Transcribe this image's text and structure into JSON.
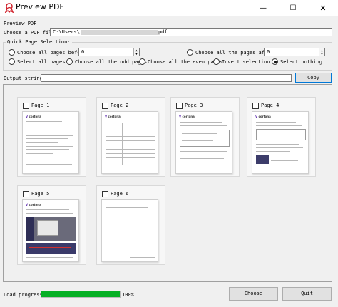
{
  "window": {
    "title": "Preview PDF",
    "minimize_glyph": "—",
    "maximize_glyph": "☐",
    "close_glyph": "✕"
  },
  "header": {
    "label": "Preview PDF"
  },
  "file": {
    "label": "Choose a PDF file:",
    "path_prefix": "C:\\Users\\",
    "path_suffix": "pdf"
  },
  "selection": {
    "group_title": "Quick Page Selection:",
    "pages_before_label": "Choose all pages before",
    "pages_before_value": "0",
    "pages_after_label": "Choose all the pages after",
    "pages_after_value": "0",
    "select_all_label": "Select all pages",
    "odd_label": "Choose all the odd pages",
    "even_label": "Choose all the even pages",
    "invert_label": "Invert selection",
    "nothing_label": "Select nothing",
    "selected": "nothing"
  },
  "output": {
    "label": "Output string:",
    "value": "",
    "copy_label": "Copy"
  },
  "pages": [
    {
      "label": "Page 1"
    },
    {
      "label": "Page 2"
    },
    {
      "label": "Page 3"
    },
    {
      "label": "Page 4"
    },
    {
      "label": "Page 5"
    },
    {
      "label": "Page 6"
    }
  ],
  "progress": {
    "label": "Load progress:",
    "value_text": "100%",
    "value": 1.0,
    "color": "#06b025"
  },
  "footer": {
    "choose_label": "Choose",
    "quit_label": "Quit"
  },
  "colors": {
    "accent": "#0078d7",
    "logo": "#6a3bb5"
  },
  "icons": {
    "app": "pdf-ribbon-icon",
    "spin": "spin-arrows-icon"
  }
}
